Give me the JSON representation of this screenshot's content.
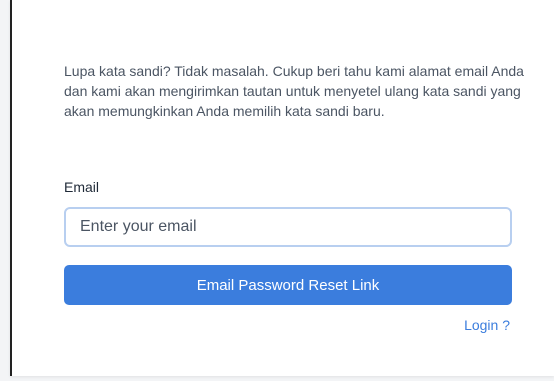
{
  "form": {
    "description": "Lupa kata sandi? Tidak masalah. Cukup beri tahu kami alamat email Anda dan kami akan mengirimkan tautan untuk menyetel ulang kata sandi yang akan memungkinkan Anda memilih kata sandi baru.",
    "email_label": "Email",
    "email_placeholder": "Enter your email",
    "email_value": "",
    "submit_label": "Email Password Reset Link",
    "login_link_label": "Login ?"
  },
  "colors": {
    "accent": "#3b7ddd",
    "input_border": "#b8cff0",
    "text": "#4b5563"
  }
}
